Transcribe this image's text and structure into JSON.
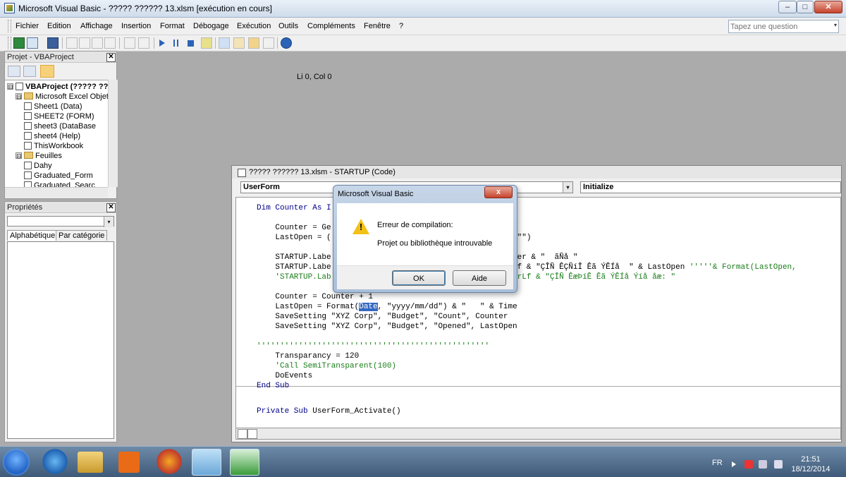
{
  "window": {
    "title": "Microsoft Visual Basic - ????? ?????? 13.xlsm [exécution en cours]",
    "minimize": "‒",
    "maximize": "□",
    "close": "✕"
  },
  "menu": [
    "Fichier",
    "Edition",
    "Affichage",
    "Insertion",
    "Format",
    "Débogage",
    "Exécution",
    "Outils",
    "Compléments",
    "Fenêtre",
    "?"
  ],
  "help_search": {
    "placeholder": "Tapez une question",
    "dropdown": "▾"
  },
  "toolbar": {
    "position": "Li 0, Col 0"
  },
  "project_pane": {
    "title": "Projet - VBAProject",
    "close": "✕",
    "tree": [
      {
        "label": "VBAProject (????? ???",
        "level": 0,
        "kind": "project",
        "expander": "⊟"
      },
      {
        "label": "Microsoft Excel Objet",
        "level": 1,
        "kind": "folder",
        "expander": "⊟"
      },
      {
        "label": "Sheet1 (Data)",
        "level": 2,
        "kind": "sheet",
        "expander": ""
      },
      {
        "label": "SHEET2 (FORM)",
        "level": 2,
        "kind": "sheet",
        "expander": ""
      },
      {
        "label": "sheet3 (DataBase",
        "level": 2,
        "kind": "sheet",
        "expander": ""
      },
      {
        "label": "sheet4 (Help)",
        "level": 2,
        "kind": "sheet",
        "expander": ""
      },
      {
        "label": "ThisWorkbook",
        "level": 2,
        "kind": "workbook",
        "expander": ""
      },
      {
        "label": "Feuilles",
        "level": 1,
        "kind": "folder",
        "expander": "⊟"
      },
      {
        "label": "Dahy",
        "level": 2,
        "kind": "form",
        "expander": ""
      },
      {
        "label": "Graduated_Form",
        "level": 2,
        "kind": "form",
        "expander": ""
      },
      {
        "label": "Graduated_Searc",
        "level": 2,
        "kind": "form",
        "expander": ""
      }
    ]
  },
  "properties_pane": {
    "title": "Propriétés",
    "close": "✕",
    "tabs": [
      "Alphabétique",
      "Par catégorie"
    ]
  },
  "code_window": {
    "title": "????? ?????? 13.xlsm - STARTUP (Code)",
    "object_combo": "UserForm",
    "procedure_combo": "Initialize",
    "lines": [
      [
        {
          "t": "Dim Counter As I",
          "c": "kw"
        },
        {
          "t": "                                     g",
          "c": "kw"
        }
      ],
      [
        {
          "t": "    Counter = Ge",
          "c": ""
        },
        {
          "t": "                                   \", 0)",
          "c": ""
        }
      ],
      [
        {
          "t": "    LastOpen = (",
          "c": ""
        },
        {
          "t": "                                   ed\", \"\")",
          "c": ""
        }
      ],
      [
        {
          "t": "",
          "c": ""
        }
      ],
      [
        {
          "t": "    STARTUP.Labe",
          "c": ""
        },
        {
          "t": "                                   Counter & \"  ãÑå \"",
          "c": ""
        }
      ],
      [
        {
          "t": "    STARTUP.Labe",
          "c": ""
        },
        {
          "t": "                                   vbCrLf & \"ÇÎÑ ÊÇÑíÎ Êã ÝÊÍå  \" & LastOpen ",
          "c": ""
        },
        {
          "t": "'''''& Format(LastOpen,",
          "c": "cm"
        }
      ],
      [
        {
          "t": "    'STARTUP.Lab",
          "c": "cm"
        },
        {
          "t": "                                   & vbCrLf & \"ÇÎÑ ÊæÞíÊ Êã ÝÊÍå Ýíå åæ: \"",
          "c": "cm"
        }
      ],
      [
        {
          "t": "",
          "c": ""
        }
      ],
      [
        {
          "t": "    Counter = Counter + 1",
          "c": ""
        }
      ],
      [
        {
          "t": "    LastOpen = Format(",
          "c": ""
        },
        {
          "t": "Date",
          "c": "hl"
        },
        {
          "t": ", \"yyyy/mm/dd\") & \"   \" & Time",
          "c": ""
        }
      ],
      [
        {
          "t": "    SaveSetting \"XYZ Corp\", \"Budget\", \"Count\", Counter",
          "c": ""
        }
      ],
      [
        {
          "t": "    SaveSetting \"XYZ Corp\", \"Budget\", \"Opened\", LastOpen",
          "c": ""
        }
      ],
      [
        {
          "t": "",
          "c": ""
        }
      ],
      [
        {
          "t": "''''''''''''''''''''''''''''''''''''''''''''''''''",
          "c": "cm"
        }
      ],
      [
        {
          "t": "    Transparancy = 120",
          "c": ""
        }
      ],
      [
        {
          "t": "    'Call SemiTransparent(100)",
          "c": "cm"
        }
      ],
      [
        {
          "t": "    DoEvents",
          "c": ""
        }
      ],
      [
        {
          "t": "End Sub",
          "c": "kw"
        }
      ],
      [
        {
          "t": "",
          "c": ""
        }
      ],
      [
        {
          "t": "Private Sub",
          "c": "kw"
        },
        {
          "t": " UserForm_Activate()",
          "c": ""
        }
      ]
    ]
  },
  "dialog": {
    "title": "Microsoft Visual Basic",
    "close": "x",
    "message_title": "Erreur de compilation:",
    "message": "Projet ou bibliothèque introuvable",
    "ok": "OK",
    "help": "Aide"
  },
  "taskbar": {
    "language": "FR",
    "time": "21:51",
    "date": "18/12/2014"
  },
  "colors": {
    "keyword": "#00008b",
    "comment": "#1a7d1a",
    "selection": "#3468c0"
  }
}
